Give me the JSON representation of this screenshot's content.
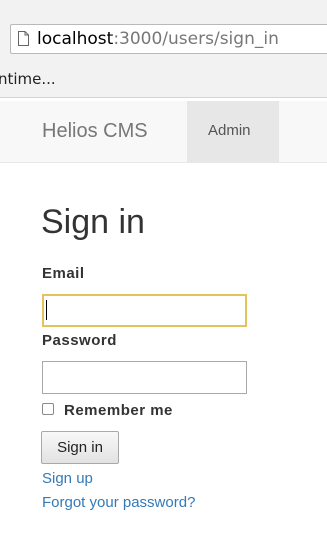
{
  "browser": {
    "url_host": "localhost",
    "url_path": ":3000/users/sign_in",
    "bookmark_label": "ntime..."
  },
  "navbar": {
    "brand": "Helios CMS",
    "admin_label": "Admin"
  },
  "form": {
    "title": "Sign in",
    "email_label": "Email",
    "email_value": "",
    "password_label": "Password",
    "password_value": "",
    "remember_label": "Remember me",
    "remember_checked": false,
    "submit_label": "Sign in"
  },
  "links": {
    "sign_up": "Sign up",
    "forgot_password": "Forgot your password?"
  },
  "colors": {
    "link": "#337ab7",
    "focus_border": "#e6c25c",
    "navbar_bg": "#f8f8f8",
    "active_nav_bg": "#e7e7e7"
  },
  "icons": {
    "url_page_icon": "page-icon"
  }
}
